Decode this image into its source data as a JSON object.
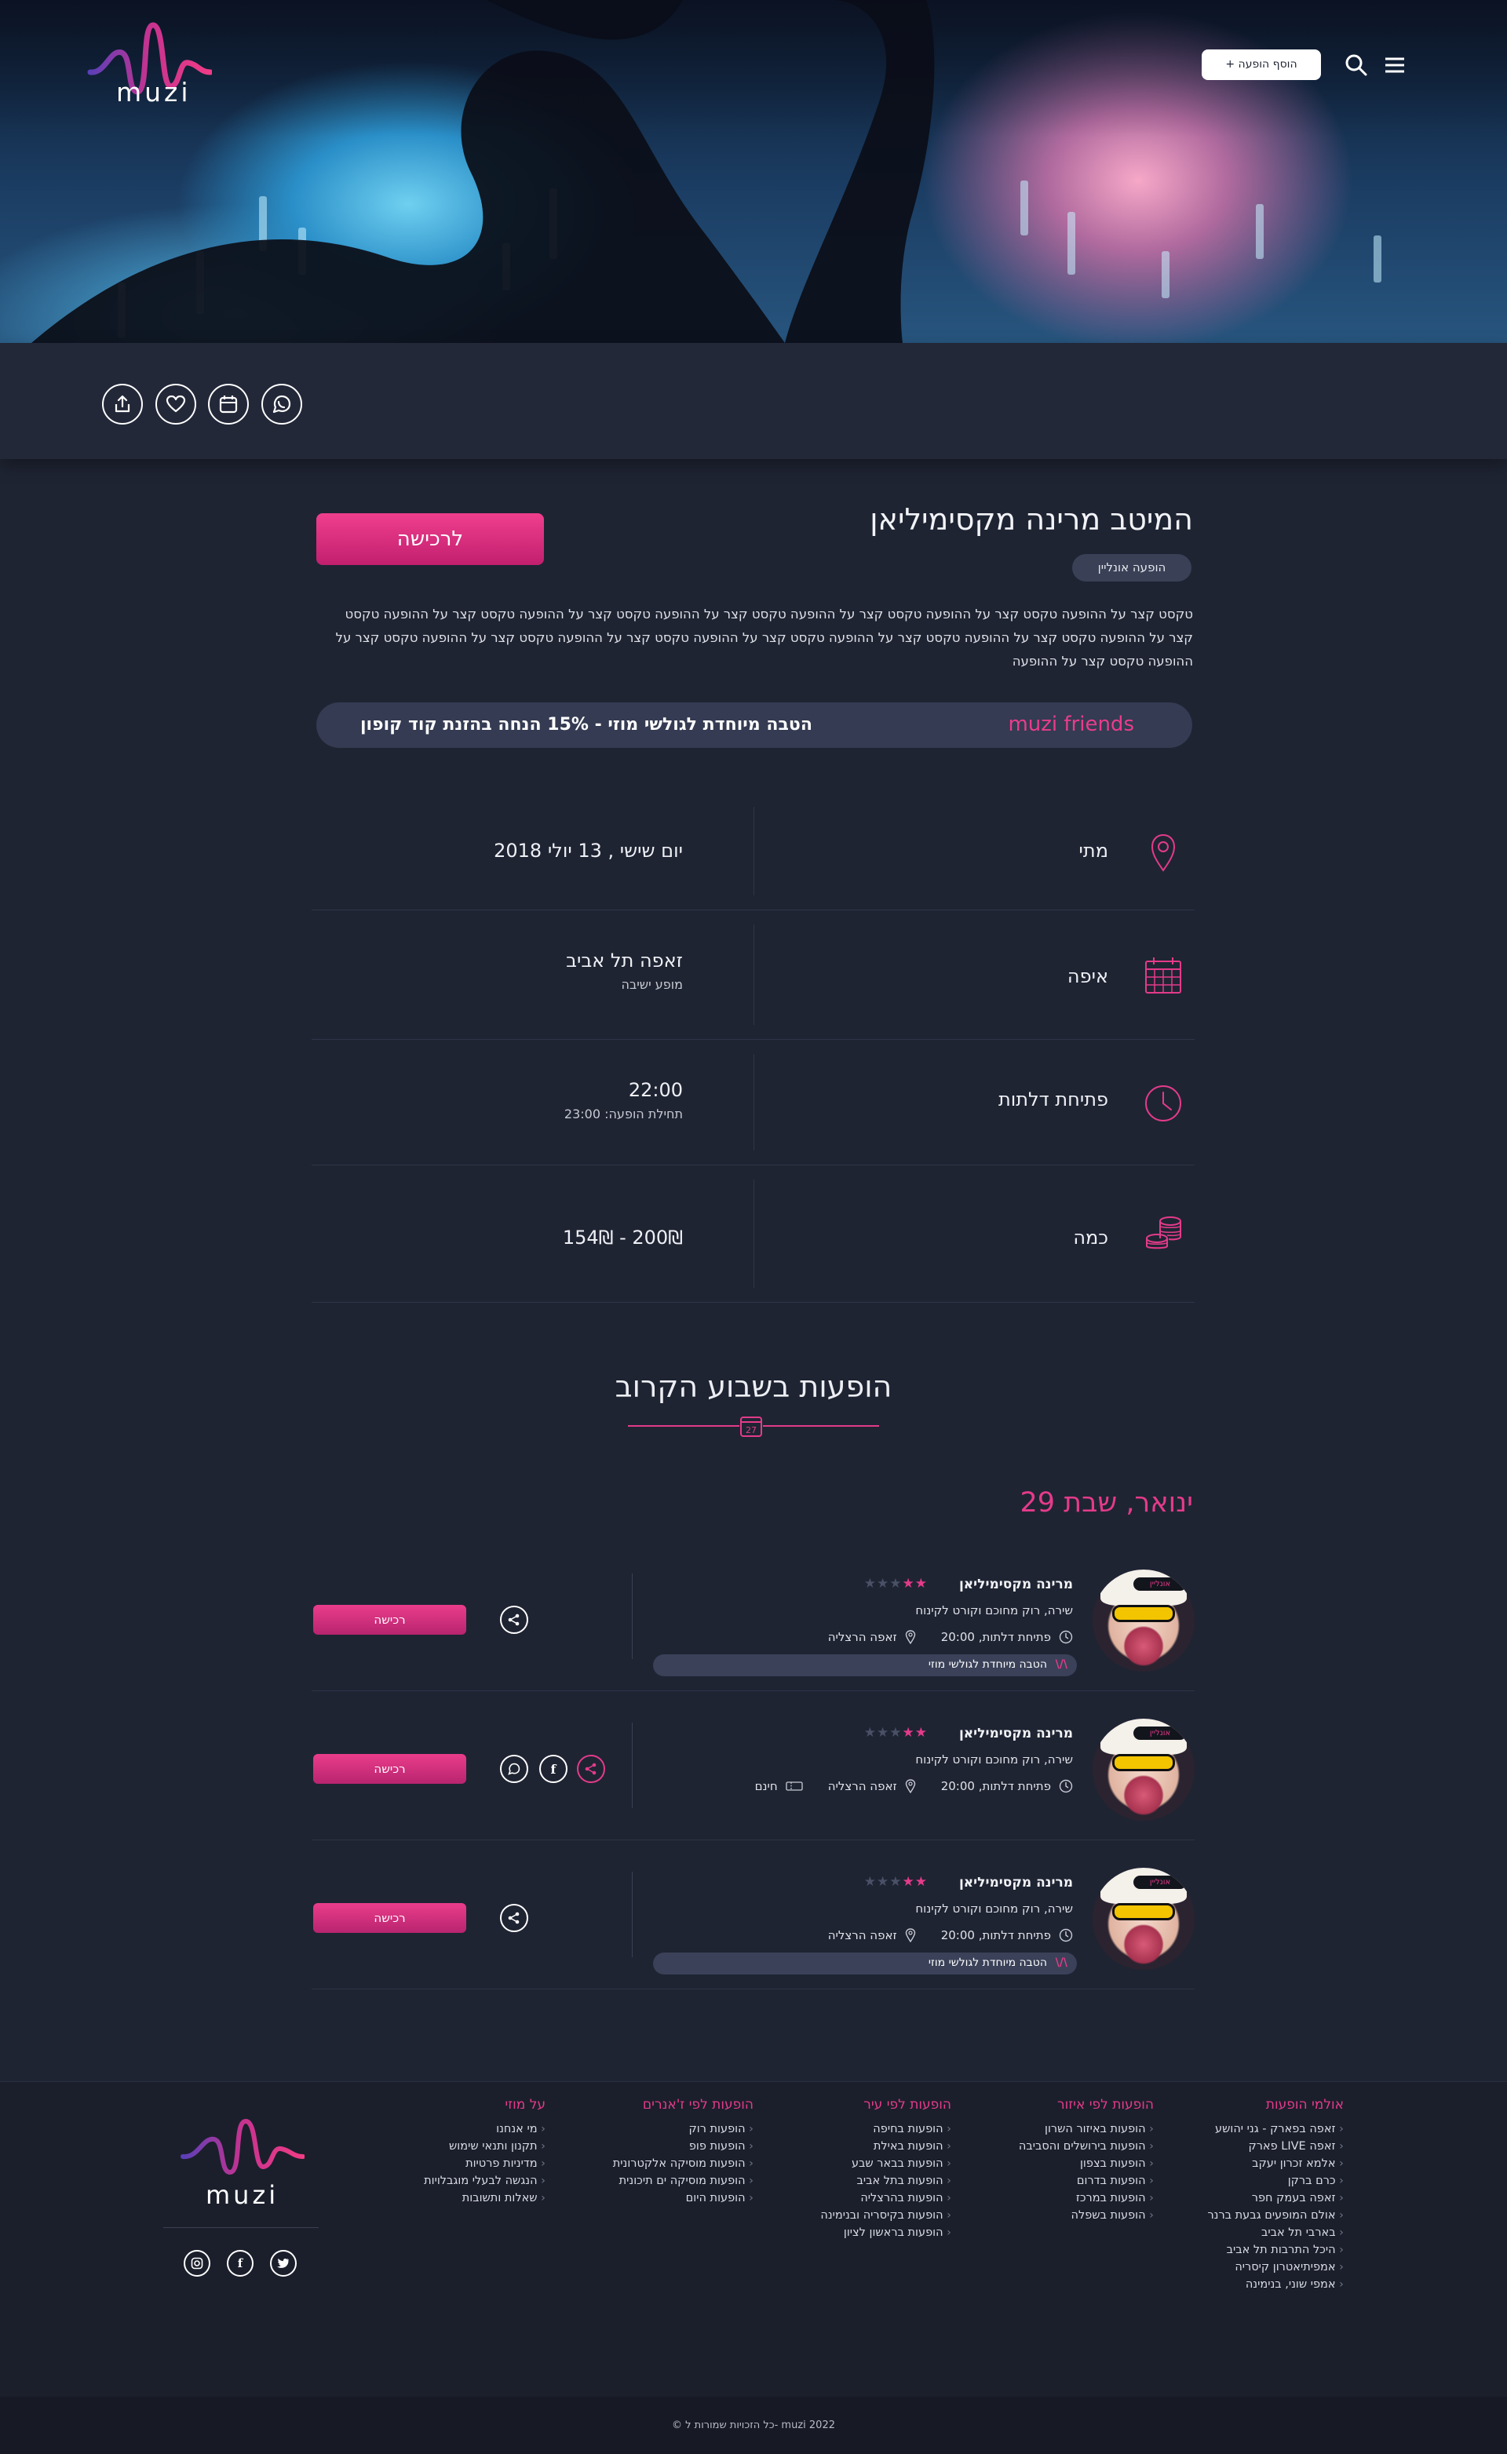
{
  "header": {
    "logo_text": "muzi",
    "add_show_label": "+ הוסף הופעה",
    "icons": [
      "search-icon",
      "menu-icon"
    ]
  },
  "action_bar": {
    "icons": [
      "share-icon",
      "heart-icon",
      "calendar-icon",
      "whatsapp-icon"
    ]
  },
  "event": {
    "title": "המיטב מרינה מקסימיליאן",
    "badge": "הופעה אונליין",
    "buy_label": "לרכישה",
    "description": "טקסט קצר על ההופעה טקסט קצר על ההופעה טקסט קצר על ההופעה טקסט קצר על ההופעה טקסט קצר על ההופעה טקסט קצר על ההופעה טקסט קצר על ההופעה טקסט קצר על ההופעה טקסט קצר על ההופעה טקסט קצר על ההופעה טקסט קצר על ההופעה טקסט קצר על ההופעה טקסט קצר על ההופעה טקסט קצר על ההופעה",
    "promo_brand": "muzi friends",
    "promo_text": "הטבה מיוחדת לגולשי מוזי - 15% הנחה בהזנת קוד קופון"
  },
  "info": {
    "when": {
      "label": "מתי",
      "value": "יום שישי , 13 יולי 2018",
      "icon": "map-pin-icon"
    },
    "where": {
      "label": "איפה",
      "value": "זאפה תל אביב",
      "sub": "מופע ישיבה",
      "icon": "calendar-grid-icon"
    },
    "doors": {
      "label": "פתיחת דלתות",
      "value": "22:00",
      "sub": "תחילת הופעה: 23:00",
      "icon": "clock-icon"
    },
    "price": {
      "label": "כמה",
      "value": "154₪ - 200₪",
      "icon": "coins-icon"
    }
  },
  "upcoming": {
    "title": "הופעות בשבוע הקרוב",
    "date_heading": "29 ינואר, שבת",
    "date_icon_day": "27",
    "accent": "#e43b8a",
    "events": [
      {
        "name": "מרינה מקסימיליאן",
        "stars_filled": 2,
        "stars_total": 5,
        "genre": "שירה, רוק מחוכם וקורט לקינוח",
        "doors": "פתיחת דלתות, 20:00",
        "venue": "זאפה הרצליה",
        "extra": "",
        "promo": "הטבה מיוחדת לגולשי מוזי",
        "tag": "אונליין",
        "buy_label": "רכישה"
      },
      {
        "name": "מרינה מקסימיליאן",
        "stars_filled": 2,
        "stars_total": 5,
        "genre": "שירה, רוק מחוכם וקורט לקינוח",
        "doors": "פתיחת דלתות, 20:00",
        "venue": "זאפה הרצליה",
        "extra": "חינם",
        "promo": "",
        "tag": "אונליין",
        "buy_label": "רכישה"
      },
      {
        "name": "מרינה מקסימיליאן",
        "stars_filled": 2,
        "stars_total": 5,
        "genre": "שירה, רוק מחוכם וקורט לקינוח",
        "doors": "פתיחת דלתות, 20:00",
        "venue": "זאפה הרצליה",
        "extra": "",
        "promo": "הטבה מיוחדת לגולשי מוזי",
        "tag": "אונליין",
        "buy_label": "רכישה"
      }
    ]
  },
  "footer": {
    "columns": [
      {
        "title": "אולמי הופעות",
        "items": [
          "זאפה בפארק - גני יהושע",
          "זאפה LIVE פארק",
          "אלמא זכרון יעקב",
          "כרם ברקן",
          "זאפה בעמק חפר",
          "אולם המופעים גבעת ברנר",
          "בארבי תל אביב",
          "היכל התרבות תל אביב",
          "אמפיתיאטרון קיסריה",
          "אמפי שוני, בנימינה"
        ]
      },
      {
        "title": "הופעות לפי איזור",
        "items": [
          "הופעות באיזור השרון",
          "הופעות בירושלים והסביבה",
          "הופעות בצפון",
          "הופעות בדרום",
          "הופעות במרכז",
          "הופעות בשפלה"
        ]
      },
      {
        "title": "הופעות לפי עיר",
        "items": [
          "הופעות בחיפה",
          "הופעות באילת",
          "הופעות בבאר שבע",
          "הופעות בתל אביב",
          "הופעות בהרצליה",
          "הופעות בקיסריה ובנימינה",
          "הופעות בראשון לציון"
        ]
      },
      {
        "title": "הופעות לפי ז'אנרים",
        "items": [
          "הופעות רוק",
          "הופעות פופ",
          "הופעות מוסיקה אלקטרונית",
          "הופעות מוסיקה ים תיכונית",
          "הופעות היום"
        ]
      },
      {
        "title": "על מוזי",
        "items": [
          "מי אנחנו",
          "תקנון ותנאי שימוש",
          "מדיניות פרטיות",
          "הנגשה לבעלי מוגבלויות",
          "שאלות ותשובות"
        ]
      }
    ],
    "logo_text": "muzi",
    "social_icons": [
      "instagram-icon",
      "facebook-icon",
      "twitter-icon"
    ],
    "copyright": "© כל הזכויות שמורות ל- muzi 2022"
  }
}
